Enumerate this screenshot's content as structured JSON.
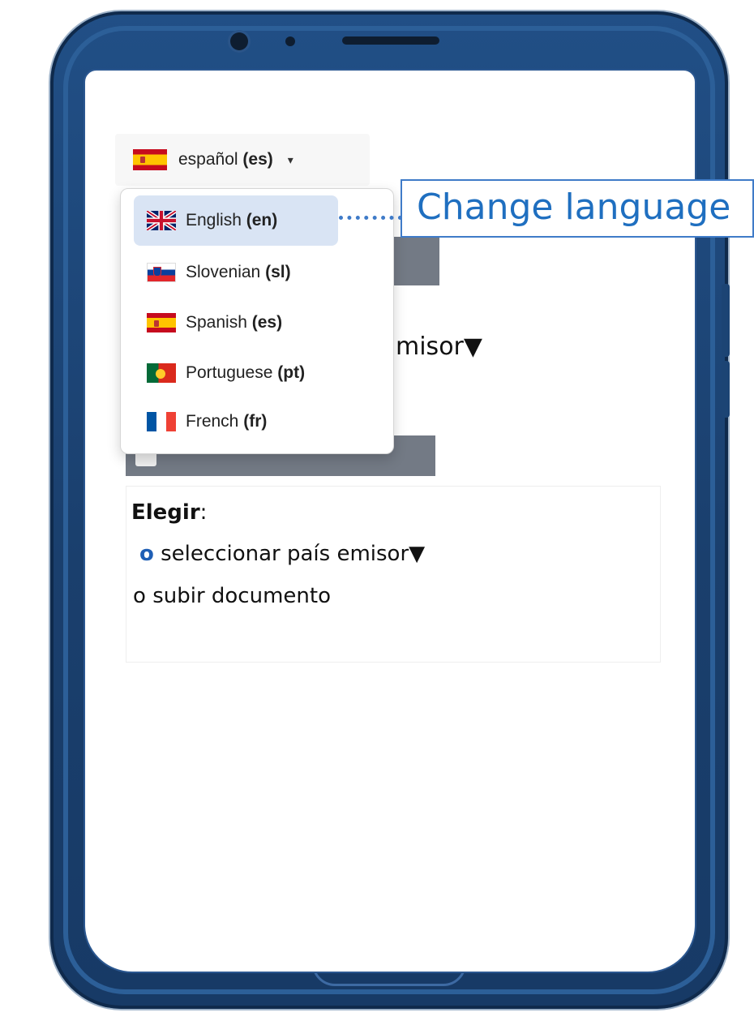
{
  "language_selector": {
    "current_label": "español",
    "current_code": "(es)",
    "current_flag": "es-flag",
    "caret": "▾"
  },
  "language_menu": {
    "options": [
      {
        "label": "English",
        "code": "(en)",
        "flag": "gb-flag",
        "selected": true
      },
      {
        "label": "Slovenian",
        "code": "(sl)",
        "flag": "si-flag"
      },
      {
        "label": "Spanish",
        "code": "(es)",
        "flag": "es-flag"
      },
      {
        "label": "Portuguese",
        "code": "(pt)",
        "flag": "pt-flag"
      },
      {
        "label": "French",
        "code": "(fr)",
        "flag": "fr-flag"
      }
    ]
  },
  "background": {
    "partial_text": "misor▼"
  },
  "choose_card": {
    "title_bold": "Elegir",
    "title_rest": ":",
    "option_select_bullet": "o",
    "option_select_label": "seleccionar país emisor▼",
    "option_upload_bullet": "o",
    "option_upload_label": "subir documento"
  },
  "callout": {
    "text": "Change language"
  },
  "colors": {
    "phone_frame": "#1a3f6d",
    "accent_blue": "#1f6fc0",
    "selected_option_bg": "#d9e4f4",
    "gray_button": "#737a85"
  }
}
